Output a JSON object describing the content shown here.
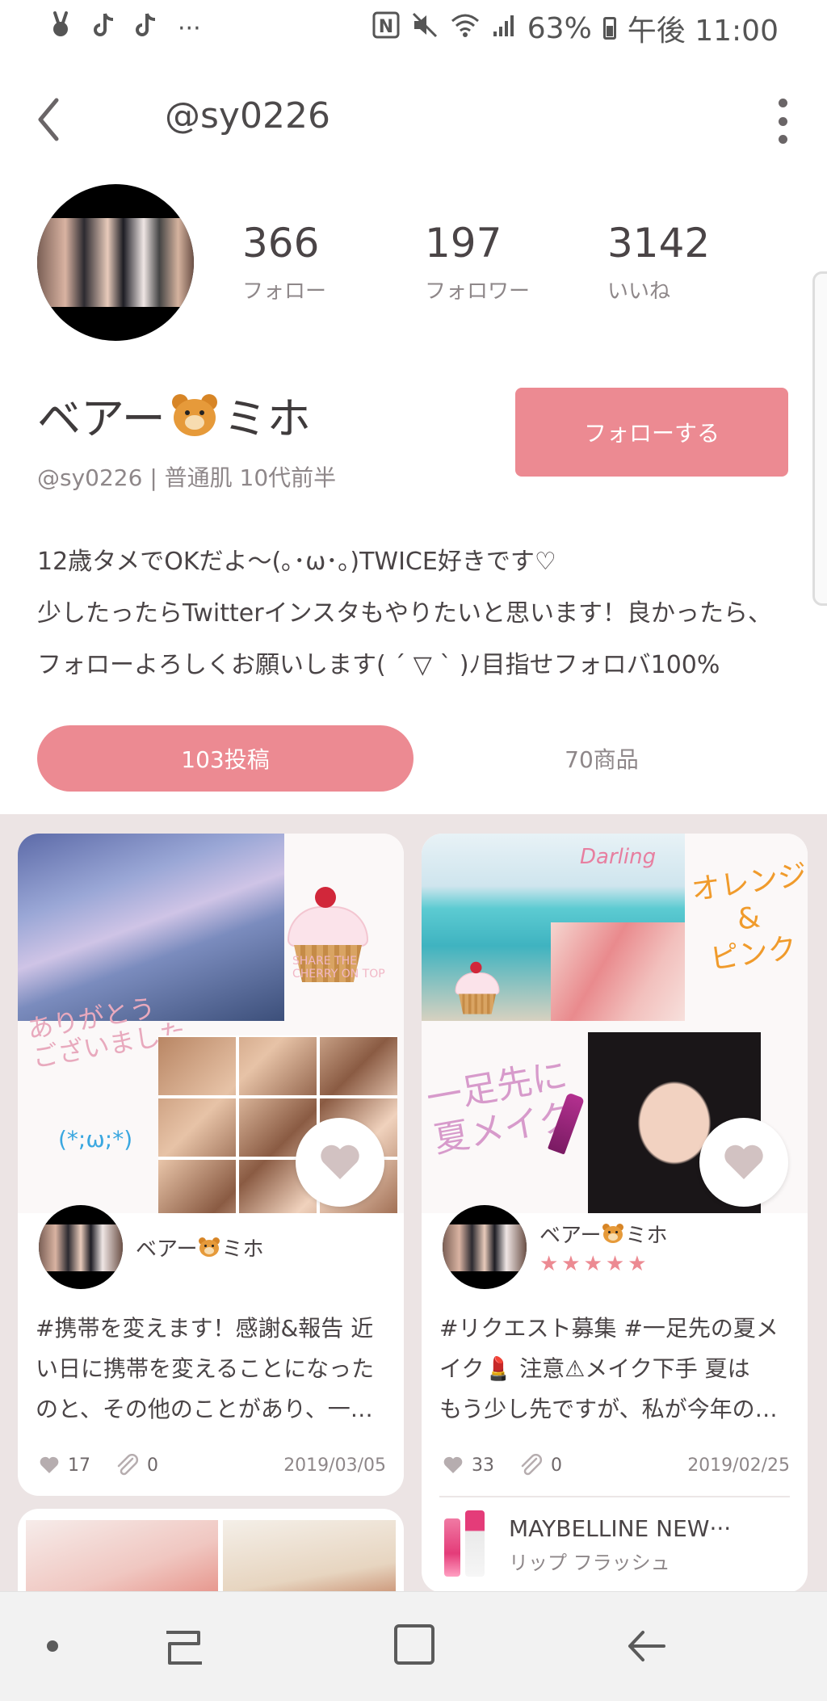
{
  "status_bar": {
    "left_icons": [
      "bunny-icon",
      "tiktok-icon",
      "tiktok-icon",
      "more-dots-icon"
    ],
    "more_dots": "···",
    "nfc": "N",
    "battery_percent": "63%",
    "time": "午後 11:00"
  },
  "header": {
    "title": "@sy0226"
  },
  "profile": {
    "stats": [
      {
        "value": "366",
        "label": "フォロー"
      },
      {
        "value": "197",
        "label": "フォロワー"
      },
      {
        "value": "3142",
        "label": "いいね"
      }
    ],
    "name_before": "ベアー",
    "name_after": "ミホ",
    "subline": "@sy0226 | 普通肌 10代前半",
    "follow_label": "フォローする",
    "bio": [
      "12歳タメでOKだよ〜(｡･ω･｡)TWICE好きです♡",
      "少したったらTwitterインスタもやりたいと思います！良かったら、",
      "フォローよろしくお願いします( ´ ▽ ` )ﾉ目指せフォロバ100%"
    ]
  },
  "tabs": {
    "posts": "103投稿",
    "items": "70商品"
  },
  "posts": [
    {
      "collage_texts": {
        "thanks": "ありがとう\nございました",
        "emoticon": "(*;ω;*)",
        "cupcake_caption": "SHARE THE\nCHERRY ON TOP"
      },
      "author_name_before": "ベアー",
      "author_name_after": "ミホ",
      "text_lines": [
        "#携帯を変えます！感謝&報告 近",
        "い日に携帯を変えることになった",
        "のと、その他のことがあり、一…"
      ],
      "likes": "17",
      "clips": "0",
      "date": "2019/03/05"
    },
    {
      "collage_texts": {
        "darling": "Darling",
        "orange_pink": "オレンジ\n&\nピンク",
        "summer": "一足先に\n夏メイク"
      },
      "author_name_before": "ベアー",
      "author_name_after": "ミホ",
      "rating_stars": 5,
      "stars_text": "★★★★★",
      "text_lines": [
        "#リクエスト募集 #一足先の夏メ",
        "イク💄 注意⚠メイク下手 夏は",
        "もう少し先ですが、私が今年の…"
      ],
      "likes": "33",
      "clips": "0",
      "date": "2019/02/25",
      "product": {
        "name": "MAYBELLINE NEW···",
        "desc": "リップ フラッシュ"
      }
    }
  ],
  "colors": {
    "accent": "#ec8a92",
    "feed_bg": "#ece4e4",
    "text": "#4a4446",
    "muted": "#8e8789"
  }
}
